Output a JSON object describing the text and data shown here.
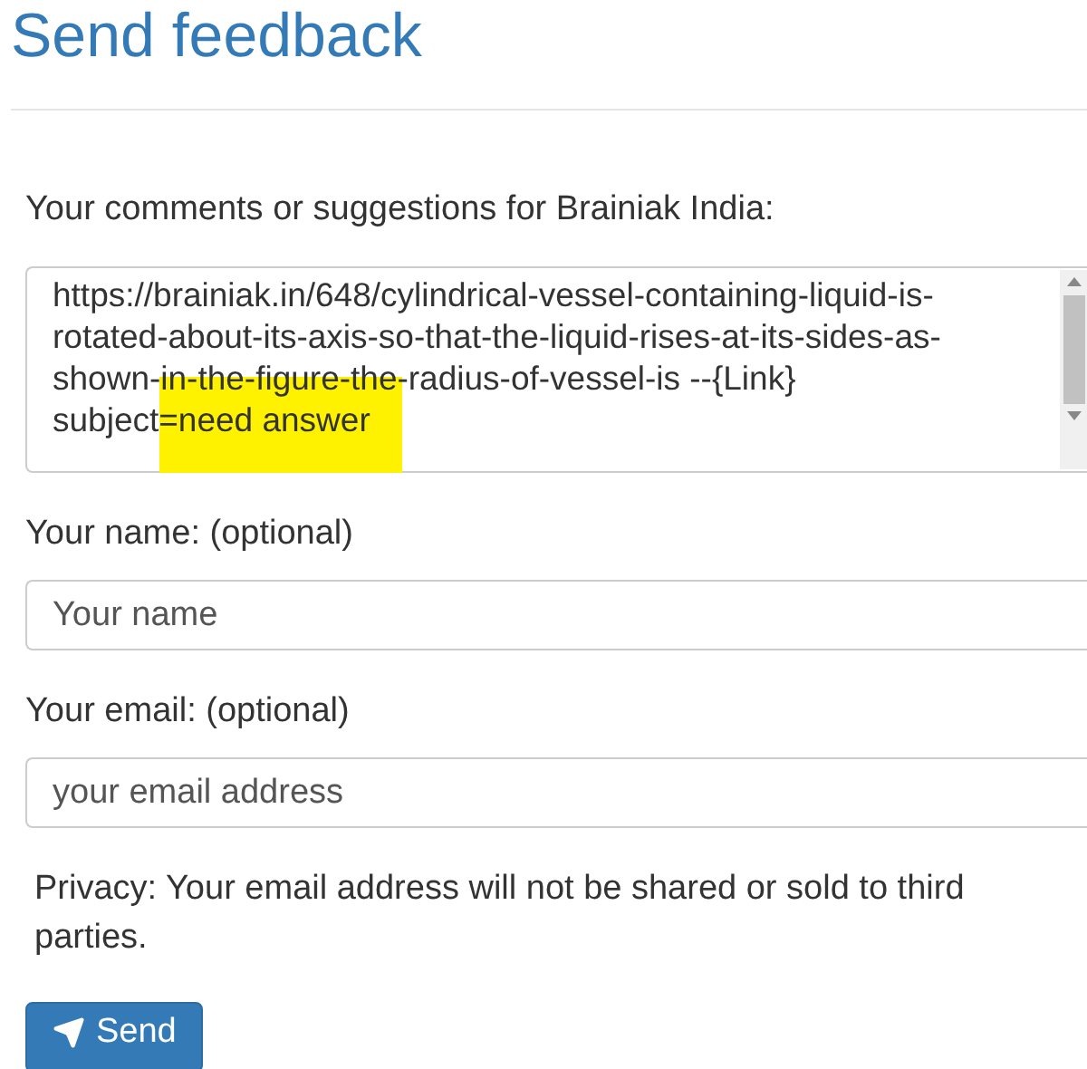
{
  "title": "Send feedback",
  "comments": {
    "label": "Your comments or suggestions for Brainiak India:",
    "value_lines": [
      "https://brainiak.in/648/cylindrical-vessel-containing-liquid-is-",
      "rotated-about-its-axis-so-that-the-liquid-rises-at-its-sides-as-",
      "shown-in-the-figure-the-radius-of-vessel-is --{Link}",
      "subject=need answer"
    ]
  },
  "name": {
    "label": "Your name: (optional)",
    "placeholder": "Your name"
  },
  "email": {
    "label": "Your email: (optional)",
    "placeholder": "your email address"
  },
  "privacy": "Privacy: Your email address will not be shared or sold to third parties.",
  "button": "Send"
}
